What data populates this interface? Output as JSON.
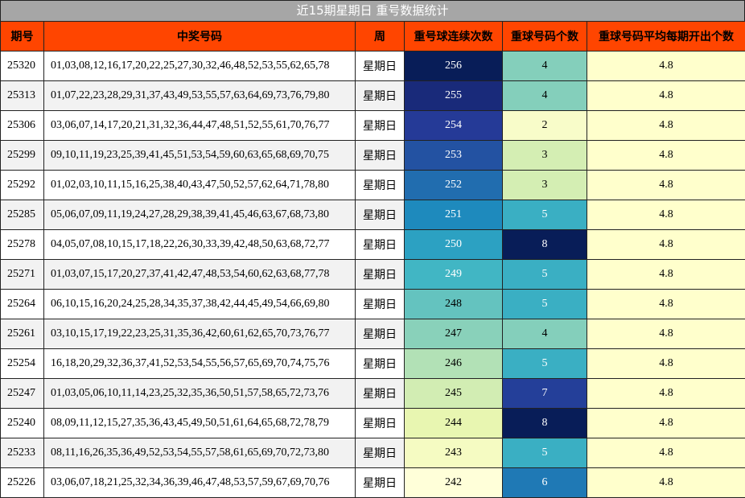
{
  "title": "近15期星期日 重号数据统计",
  "colors": {
    "header_bg": "#ff4500",
    "title_bg": "#a6a6a6",
    "avg_bg": "#ffffcc"
  },
  "chart_data": {
    "type": "table",
    "columns": [
      "期号",
      "中奖号码",
      "周",
      "重号球连续次数",
      "重球号码个数",
      "重球号码平均每期开出个数"
    ],
    "rows": [
      {
        "issue": "25320",
        "numbers": "01,03,08,12,16,17,20,22,25,27,30,32,46,48,52,53,55,62,65,78",
        "week": "星期日",
        "streak": 256,
        "repeat_count": 4,
        "avg": "4.8"
      },
      {
        "issue": "25313",
        "numbers": "01,07,22,23,28,29,31,37,43,49,53,55,57,63,64,69,73,76,79,80",
        "week": "星期日",
        "streak": 255,
        "repeat_count": 4,
        "avg": "4.8"
      },
      {
        "issue": "25306",
        "numbers": "03,06,07,14,17,20,21,31,32,36,44,47,48,51,52,55,61,70,76,77",
        "week": "星期日",
        "streak": 254,
        "repeat_count": 2,
        "avg": "4.8"
      },
      {
        "issue": "25299",
        "numbers": "09,10,11,19,23,25,39,41,45,51,53,54,59,60,63,65,68,69,70,75",
        "week": "星期日",
        "streak": 253,
        "repeat_count": 3,
        "avg": "4.8"
      },
      {
        "issue": "25292",
        "numbers": "01,02,03,10,11,15,16,25,38,40,43,47,50,52,57,62,64,71,78,80",
        "week": "星期日",
        "streak": 252,
        "repeat_count": 3,
        "avg": "4.8"
      },
      {
        "issue": "25285",
        "numbers": "05,06,07,09,11,19,24,27,28,29,38,39,41,45,46,63,67,68,73,80",
        "week": "星期日",
        "streak": 251,
        "repeat_count": 5,
        "avg": "4.8"
      },
      {
        "issue": "25278",
        "numbers": "04,05,07,08,10,15,17,18,22,26,30,33,39,42,48,50,63,68,72,77",
        "week": "星期日",
        "streak": 250,
        "repeat_count": 8,
        "avg": "4.8"
      },
      {
        "issue": "25271",
        "numbers": "01,03,07,15,17,20,27,37,41,42,47,48,53,54,60,62,63,68,77,78",
        "week": "星期日",
        "streak": 249,
        "repeat_count": 5,
        "avg": "4.8"
      },
      {
        "issue": "25264",
        "numbers": "06,10,15,16,20,24,25,28,34,35,37,38,42,44,45,49,54,66,69,80",
        "week": "星期日",
        "streak": 248,
        "repeat_count": 5,
        "avg": "4.8"
      },
      {
        "issue": "25261",
        "numbers": "03,10,15,17,19,22,23,25,31,35,36,42,60,61,62,65,70,73,76,77",
        "week": "星期日",
        "streak": 247,
        "repeat_count": 4,
        "avg": "4.8"
      },
      {
        "issue": "25254",
        "numbers": "16,18,20,29,32,36,37,41,52,53,54,55,56,57,65,69,70,74,75,76",
        "week": "星期日",
        "streak": 246,
        "repeat_count": 5,
        "avg": "4.8"
      },
      {
        "issue": "25247",
        "numbers": "01,03,05,06,10,11,14,23,25,32,35,36,50,51,57,58,65,72,73,76",
        "week": "星期日",
        "streak": 245,
        "repeat_count": 7,
        "avg": "4.8"
      },
      {
        "issue": "25240",
        "numbers": "08,09,11,12,15,27,35,36,43,45,49,50,51,61,64,65,68,72,78,79",
        "week": "星期日",
        "streak": 244,
        "repeat_count": 8,
        "avg": "4.8"
      },
      {
        "issue": "25233",
        "numbers": "08,11,16,26,35,36,49,52,53,54,55,57,58,61,65,69,70,72,73,80",
        "week": "星期日",
        "streak": 243,
        "repeat_count": 5,
        "avg": "4.8"
      },
      {
        "issue": "25226",
        "numbers": "03,06,07,18,21,25,32,34,36,39,46,47,48,53,57,59,67,69,70,76",
        "week": "星期日",
        "streak": 242,
        "repeat_count": 6,
        "avg": "4.8"
      }
    ]
  }
}
